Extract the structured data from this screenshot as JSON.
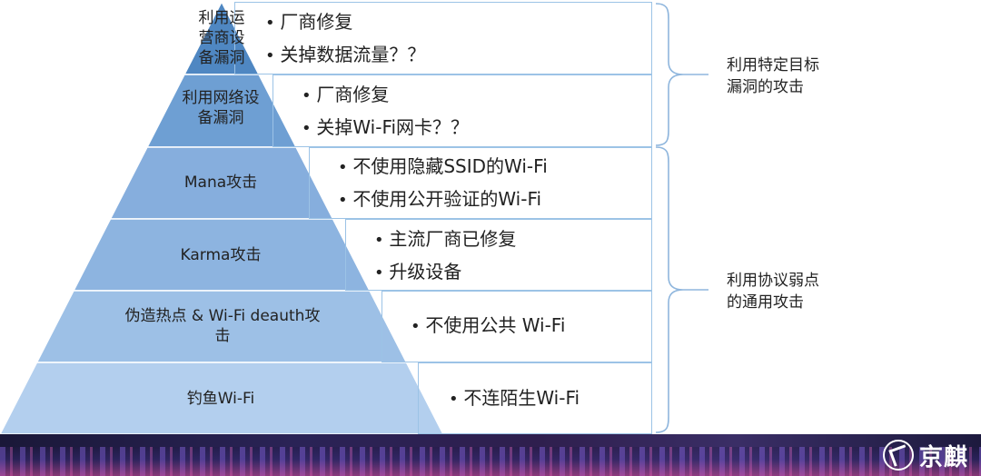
{
  "levels": [
    {
      "label": "利用运营商设备漏洞",
      "lines": [
        "利用运",
        "营商设",
        "备漏洞"
      ],
      "bullets": [
        "厂商修复",
        "关掉数据流量？？"
      ],
      "color": "#4f87c2"
    },
    {
      "label": "利用网络设备漏洞",
      "lines": [
        "利用网络设",
        "备漏洞"
      ],
      "bullets": [
        "厂商修复",
        "关掉Wi-Fi网卡？？"
      ],
      "color": "#6e9fd3"
    },
    {
      "label": "Mana攻击",
      "lines": [
        "Mana攻击"
      ],
      "bullets": [
        "不使用隐藏SSID的Wi-Fi",
        "不使用公开验证的Wi-Fi"
      ],
      "color": "#86aedd"
    },
    {
      "label": "Karma攻击",
      "lines": [
        "Karma攻击"
      ],
      "bullets": [
        "主流厂商已修复",
        "升级设备"
      ],
      "color": "#8db4e0"
    },
    {
      "label": "伪造热点 & Wi-Fi deauth攻击",
      "lines": [
        "伪造热点 & Wi-Fi deauth攻",
        "击"
      ],
      "bullets": [
        "不使用公共 Wi-Fi"
      ],
      "color": "#9dc0e6"
    },
    {
      "label": "钓鱼Wi-Fi",
      "lines": [
        "钓鱼Wi-Fi"
      ],
      "bullets": [
        "不连陌生Wi-Fi"
      ],
      "color": "#b3cfee"
    }
  ],
  "categories": [
    {
      "lines": [
        "利用特定目标",
        "漏洞的攻击"
      ]
    },
    {
      "lines": [
        "利用协议弱点",
        "的通用攻击"
      ]
    }
  ],
  "brand": {
    "name": "京麒"
  },
  "colors": {
    "box_border": "#9cc3e6",
    "bracket": "#8fb6dd"
  }
}
